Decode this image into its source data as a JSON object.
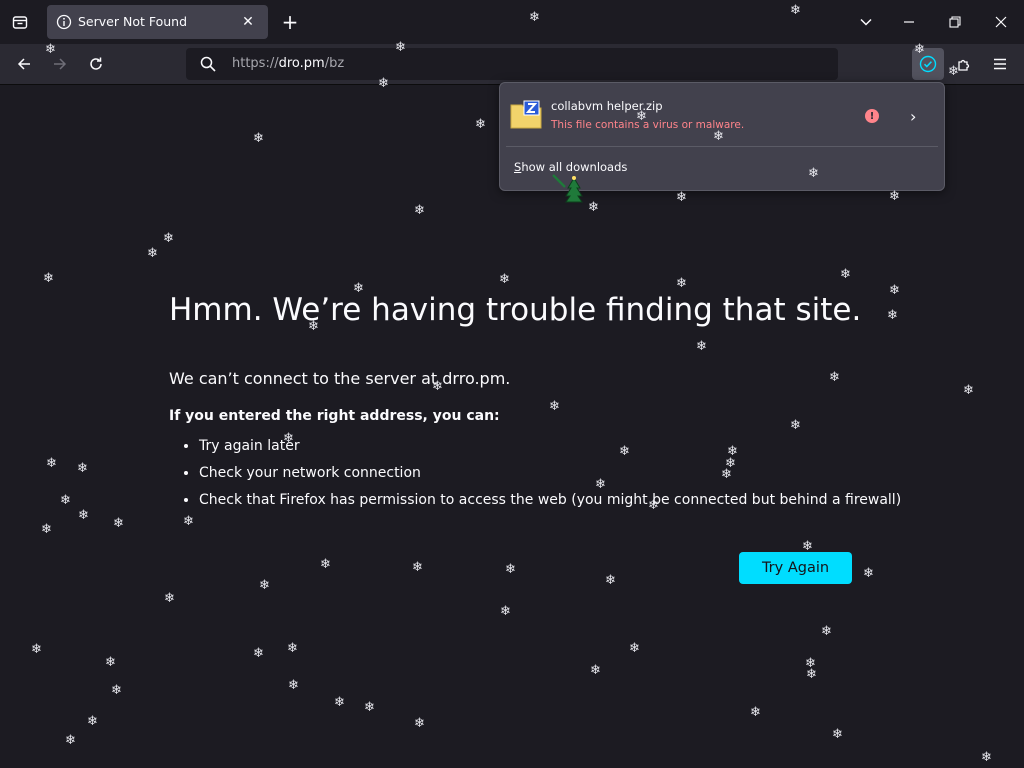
{
  "tab": {
    "title": "Server Not Found",
    "close": "✕",
    "new_tab": "+"
  },
  "url": {
    "scheme": "https://",
    "host": "dro.pm",
    "path": "/bz"
  },
  "window_controls": {
    "list_all": "⌄",
    "minimize": "—",
    "restore": "❐",
    "close": "✕"
  },
  "downloads": {
    "file_name": "collabvm helper.zip",
    "status": "This file contains a virus or malware.",
    "warn_glyph": "!",
    "chevron": "›",
    "show_all_prefix": "S",
    "show_all_label": "how all downloads"
  },
  "error": {
    "title": "Hmm. We’re having trouble finding that site.",
    "description": "We can’t connect to the server at drro.pm.",
    "subheading": "If you entered the right address, you can:",
    "tips": [
      "Try again later",
      "Check your network connection",
      "Check that Firefox has permission to access the web (you might be connected but behind a firewall)"
    ],
    "try_again": "Try Again"
  },
  "colors": {
    "accent": "#00ddff",
    "warning": "#ff848b",
    "background": "#1c1b22"
  },
  "icons": [
    "tab-list-icon",
    "info-icon",
    "back-icon",
    "forward-icon",
    "reload-icon",
    "search-icon",
    "download-done-icon",
    "extensions-icon",
    "menu-icon",
    "zip-file-icon"
  ]
}
